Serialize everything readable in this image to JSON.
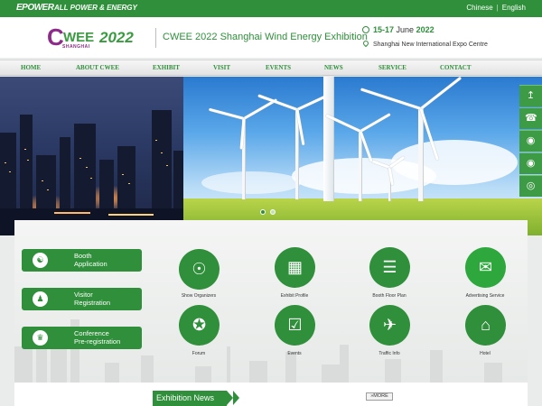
{
  "topbar": {
    "logo_left": "EPOWER",
    "logo_right": "ALL POWER & ENERGY",
    "lang_chinese": "Chinese",
    "lang_english": "English",
    "bg_color": "#2f8f3a"
  },
  "header": {
    "brand_c": "C",
    "brand_wee": "WEE",
    "brand_year": "2022",
    "brand_city": "SHANGHAI",
    "title": "CWEE 2022 Shanghai Wind Energy Exhibition",
    "date_days": "15-17",
    "date_month": "June",
    "date_year": "2022",
    "venue": "Shanghai New International Expo Centre",
    "clock_icon": "clock-icon",
    "location_icon": "location-pin-icon"
  },
  "nav": {
    "items": [
      "HOME",
      "ABOUT CWEE",
      "EXHIBIT",
      "VISIT",
      "EVENTS",
      "NEWS",
      "SERVICE",
      "CONTACT"
    ]
  },
  "hero": {
    "slides": 2,
    "active_slide": 1
  },
  "side_buttons": [
    {
      "icon": "back-to-top-icon"
    },
    {
      "icon": "phone-icon"
    },
    {
      "icon": "qq-icon"
    },
    {
      "icon": "qq-icon"
    },
    {
      "icon": "weibo-icon"
    }
  ],
  "left_buttons": [
    {
      "label_line1": "Booth",
      "label_line2": "Application",
      "icon": "handshake-icon"
    },
    {
      "label_line1": "Visitor",
      "label_line2": "Registration",
      "icon": "visitors-icon"
    },
    {
      "label_line1": "Conference",
      "label_line2": "Pre-registration",
      "icon": "conference-icon"
    }
  ],
  "services": [
    {
      "label": "Show Organizers",
      "icon": "globe-icon"
    },
    {
      "label": "Exhibit Profile",
      "icon": "calendar-icon"
    },
    {
      "label": "Booth Floor Plan",
      "icon": "clipboard-icon"
    },
    {
      "label": "Advertising Service",
      "icon": "megaphone-icon"
    },
    {
      "label": "Forum",
      "icon": "medal-icon"
    },
    {
      "label": "Events",
      "icon": "checklist-icon"
    },
    {
      "label": "Traffic Info",
      "icon": "airplane-icon"
    },
    {
      "label": "Hotel",
      "icon": "hotel-icon"
    }
  ],
  "bottom": {
    "news_title": "Exhibition News",
    "more_label": "MORE"
  }
}
